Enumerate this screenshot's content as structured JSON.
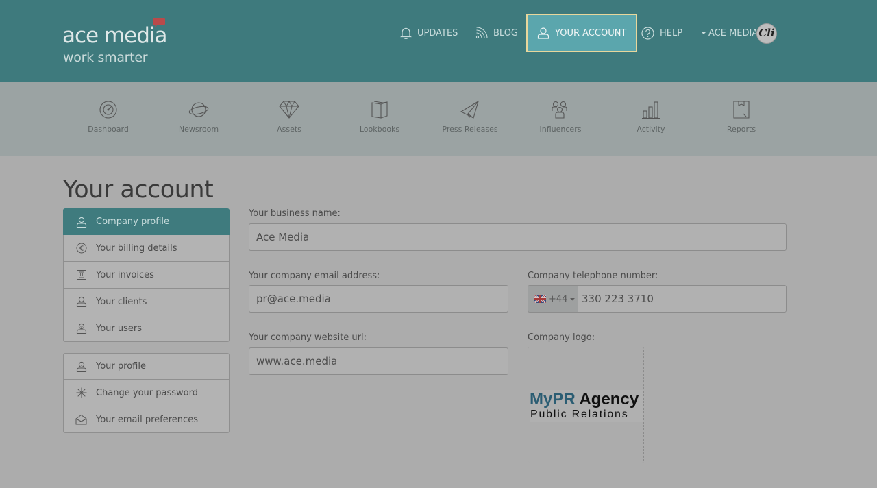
{
  "brand": {
    "name": "ace media",
    "tagline": "work smarter"
  },
  "topnav": {
    "updates": "UPDATES",
    "blog": "BLOG",
    "account": "YOUR ACCOUNT",
    "help": "HELP",
    "user": "ACE MEDIA",
    "avatar_text": "Cli"
  },
  "subnav": [
    {
      "label": "Dashboard",
      "icon": "dashboard-icon"
    },
    {
      "label": "Newsroom",
      "icon": "newsroom-icon"
    },
    {
      "label": "Assets",
      "icon": "diamond-icon"
    },
    {
      "label": "Lookbooks",
      "icon": "lookbook-icon"
    },
    {
      "label": "Press Releases",
      "icon": "paper-plane-icon"
    },
    {
      "label": "Influencers",
      "icon": "people-icon"
    },
    {
      "label": "Activity",
      "icon": "bar-chart-icon"
    },
    {
      "label": "Reports",
      "icon": "report-icon"
    }
  ],
  "page": {
    "title": "Your account"
  },
  "sidemenu": {
    "group1": [
      {
        "label": "Company profile",
        "icon": "user-icon",
        "active": true
      },
      {
        "label": "Your billing details",
        "icon": "euro-icon"
      },
      {
        "label": "Your invoices",
        "icon": "invoice-icon"
      },
      {
        "label": "Your clients",
        "icon": "user-icon"
      },
      {
        "label": "Your users",
        "icon": "user-icon"
      }
    ],
    "group2": [
      {
        "label": "Your profile",
        "icon": "user-icon"
      },
      {
        "label": "Change your password",
        "icon": "asterisk-icon"
      },
      {
        "label": "Your email preferences",
        "icon": "envelope-icon"
      }
    ]
  },
  "form": {
    "business_name_label": "Your business name:",
    "business_name": "Ace Media",
    "email_label": "Your company email address:",
    "email": "pr@ace.media",
    "phone_label": "Company telephone number:",
    "phone_prefix": "+44",
    "phone": "330 223 3710",
    "website_label": "Your company website url:",
    "website": "www.ace.media",
    "logo_label": "Company logo:",
    "logo_line1_a": "MyPR",
    "logo_line1_b": " Agency",
    "logo_line2": "Public Relations"
  },
  "colors": {
    "header_bg": "#3e7a7d",
    "accent_active": "#5ba6ad",
    "active_border": "#e8d79c"
  }
}
